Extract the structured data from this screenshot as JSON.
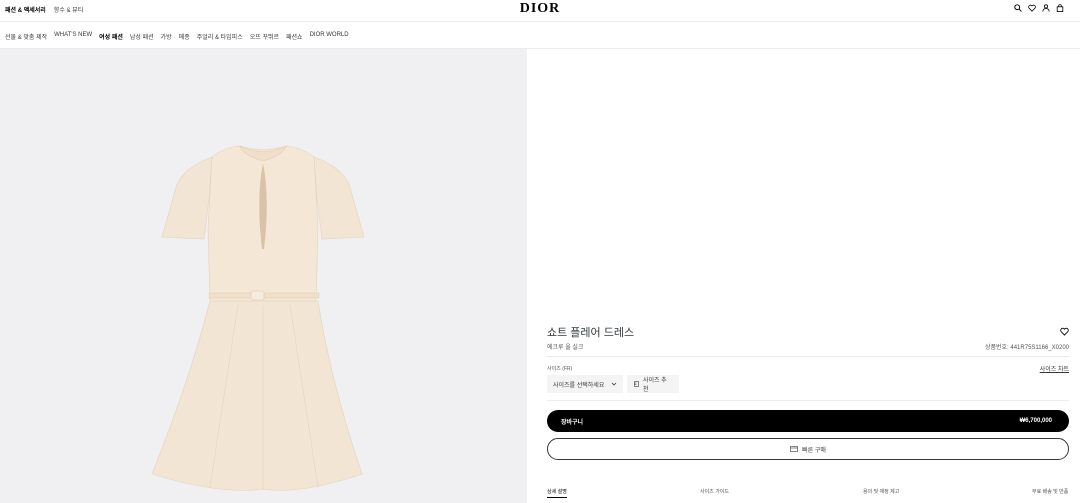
{
  "topbar": {
    "links": [
      "패션 & 액세서리",
      "향수 & 뷰티"
    ],
    "logo": "DIOR",
    "icons": [
      "search-icon",
      "heart-icon",
      "user-icon",
      "bag-icon"
    ]
  },
  "nav": {
    "items": [
      "선물 & 맞춤 제작",
      "WHAT'S NEW",
      "여성 패션",
      "남성 패션",
      "가방",
      "메종",
      "주얼리 & 타임피스",
      "오뜨 꾸뛰르",
      "패션쇼",
      "DIOR WORLD"
    ],
    "active": "여성 패션"
  },
  "product": {
    "name": "쇼트 플레어 드레스",
    "material": "에크루 울 실크",
    "code": "상품번호: 441R75S1166_X0200",
    "size_label": "사이즈 (FR)",
    "size_chart": "사이즈 차트",
    "size_select": "사이즈를 선택하세요",
    "size_reco": "사이즈 추천",
    "cart_label": "장바구니",
    "price": "₩6,700,000",
    "quick_buy": "빠른 구매"
  },
  "tabs": [
    "상세 설명",
    "사이즈 가이드",
    "용의 및 재정 제고",
    "무료 배송 및 반품"
  ],
  "colors": {
    "accent": "#000000",
    "dress": "#f3e5d3",
    "panel_bg": "#f0f0f2"
  }
}
